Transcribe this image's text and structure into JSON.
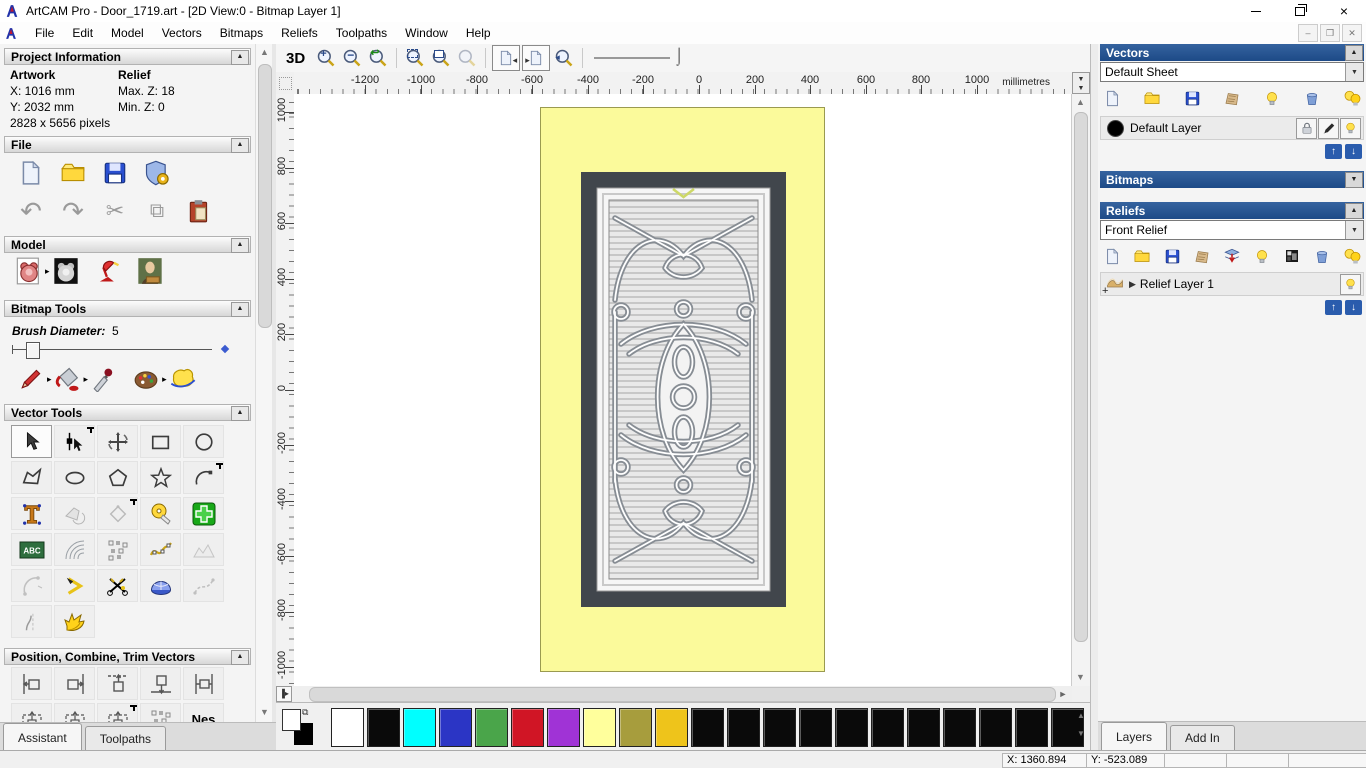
{
  "window": {
    "title": "ArtCAM Pro - Door_1719.art - [2D View:0 - Bitmap Layer 1]"
  },
  "menu": {
    "items": [
      "File",
      "Edit",
      "Model",
      "Vectors",
      "Bitmaps",
      "Reliefs",
      "Toolpaths",
      "Window",
      "Help"
    ]
  },
  "assistant": {
    "sections": {
      "project_information": {
        "title": "Project Information",
        "artwork_label": "Artwork",
        "relief_label": "Relief",
        "artwork_x": "X: 1016 mm",
        "artwork_y": "Y: 2032 mm",
        "artwork_pixels": "2828 x 5656 pixels",
        "relief_max": "Max. Z: 18",
        "relief_min": "Min. Z: 0"
      },
      "file": {
        "title": "File"
      },
      "model": {
        "title": "Model"
      },
      "bitmap_tools": {
        "title": "Bitmap Tools",
        "brush_label": "Brush Diameter:",
        "brush_value": "5"
      },
      "vector_tools": {
        "title": "Vector Tools",
        "text_block_label": "ABC"
      },
      "position": {
        "title": "Position, Combine, Trim Vectors",
        "nest_label": "Nes"
      }
    },
    "tabs": {
      "assistant": "Assistant",
      "toolpaths": "Toolpaths"
    }
  },
  "canvas": {
    "toolbar": {
      "view_3d": "3D"
    },
    "ruler": {
      "units": "millimetres",
      "h_labels": [
        "-1200",
        "-1000",
        "-800",
        "-600",
        "-400",
        "-200",
        "0",
        "200",
        "400",
        "600",
        "800",
        "1000"
      ],
      "v_labels": [
        "1000",
        "800",
        "600",
        "400",
        "200",
        "0",
        "-200",
        "-400",
        "-600",
        "-800",
        "-1000"
      ]
    },
    "artwork": {
      "sheet_color": "#fbfa9b",
      "door_slab_color": "#41464c"
    }
  },
  "right_panel": {
    "vectors": {
      "title": "Vectors",
      "sheet_selected": "Default Sheet",
      "layer_name": "Default Layer"
    },
    "bitmaps": {
      "title": "Bitmaps"
    },
    "reliefs": {
      "title": "Reliefs",
      "relief_selected": "Front Relief",
      "layer_name": "Relief Layer 1"
    },
    "tabs": {
      "layers": "Layers",
      "addin": "Add In"
    }
  },
  "status_bar": {
    "x": "X: 1360.894",
    "y": "Y: -523.089"
  },
  "palette": {
    "primary": "#ffffff",
    "secondary": "#000000",
    "colors": [
      "#ffffff",
      "#0a0a0a",
      "#00ffff",
      "#2b35c5",
      "#4aa54a",
      "#d01525",
      "#a033d6",
      "#ffff9c",
      "#a79d3d",
      "#eec41b",
      "#0a0a0a",
      "#0a0a0a",
      "#0a0a0a",
      "#0a0a0a",
      "#0a0a0a",
      "#0a0a0a",
      "#0a0a0a",
      "#0a0a0a",
      "#0a0a0a",
      "#0a0a0a",
      "#0a0a0a"
    ]
  }
}
